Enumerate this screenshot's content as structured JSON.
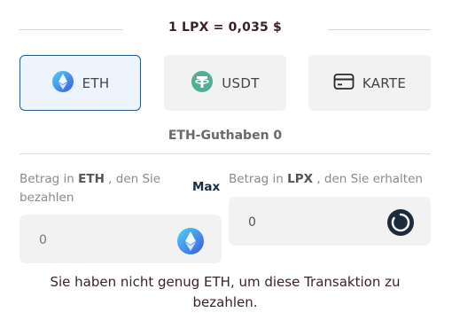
{
  "rate": {
    "text": "1 LPX = 0,035 $"
  },
  "payment_methods": [
    {
      "label": "ETH",
      "icon": "ethereum-icon",
      "selected": true
    },
    {
      "label": "USDT",
      "icon": "tether-icon",
      "selected": false
    },
    {
      "label": "KARTE",
      "icon": "credit-card-icon",
      "selected": false
    }
  ],
  "balance": {
    "text": "ETH-Guthaben 0"
  },
  "pay_field": {
    "label_prefix": "Betrag in ",
    "label_currency": "ETH",
    "label_suffix": " , den Sie bezahlen",
    "placeholder": "0",
    "max_label": "Max",
    "icon": "ethereum-icon"
  },
  "receive_field": {
    "label_prefix": "Betrag in ",
    "label_currency": "LPX",
    "label_suffix": " , den Sie erhalten",
    "value": "0",
    "icon": "lpx-token-icon"
  },
  "warning": {
    "text": "Sie haben nicht genug ETH, um diese Transaktion zu bezahlen."
  },
  "colors": {
    "accent_border": "#2a5a8c",
    "text_dark": "#3a1f2c",
    "field_bg": "#f2f2f2"
  }
}
